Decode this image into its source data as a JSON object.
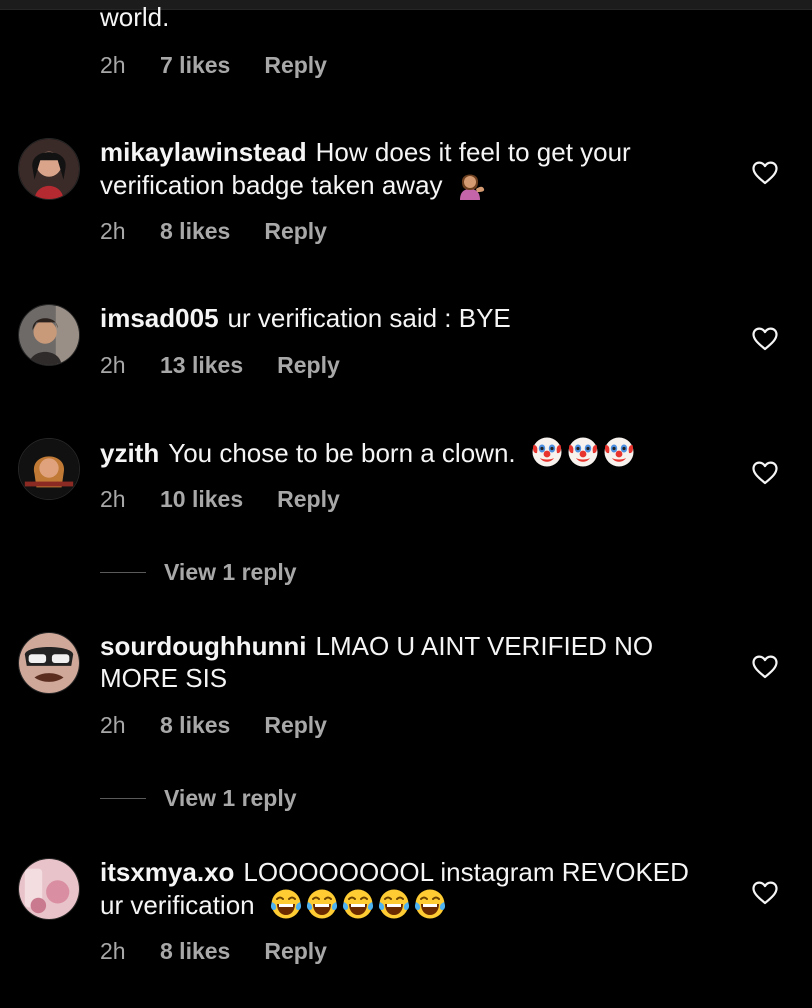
{
  "partial_comment": {
    "text_tail": "world.",
    "time": "2h",
    "likes": "7 likes",
    "reply": "Reply"
  },
  "comments": [
    {
      "username": "mikaylawinstead",
      "text": "How does it feel to get your verification badge taken away",
      "emoji": [
        "person-tipping-hand"
      ],
      "time": "2h",
      "likes": "8 likes",
      "reply": "Reply",
      "avatar": "avatar-mikaylawinstead"
    },
    {
      "username": "imsad005",
      "text": "ur verification said : BYE",
      "time": "2h",
      "likes": "13 likes",
      "reply": "Reply",
      "avatar": "avatar-imsad005"
    },
    {
      "username": "yzith",
      "text": "You chose to be born a clown.",
      "emoji": [
        "clown-face",
        "clown-face",
        "clown-face"
      ],
      "time": "2h",
      "likes": "10 likes",
      "reply": "Reply",
      "view_replies": "View 1 reply",
      "avatar": "avatar-yzith"
    },
    {
      "username": "sourdoughhunni",
      "text": "LMAO U AINT VERIFIED NO MORE SIS",
      "time": "2h",
      "likes": "8 likes",
      "reply": "Reply",
      "view_replies": "View 1 reply",
      "avatar": "avatar-sourdoughhunni"
    },
    {
      "username": "itsxmya.xo",
      "text": "LOOOOOOOOL instagram REVOKED ur verification",
      "emoji": [
        "tears-of-joy",
        "tears-of-joy",
        "tears-of-joy",
        "tears-of-joy",
        "tears-of-joy"
      ],
      "time": "2h",
      "likes": "8 likes",
      "reply": "Reply",
      "avatar": "avatar-itsxmya"
    }
  ],
  "icons": {
    "like": "heart-outline-icon"
  },
  "colors": {
    "background": "#000000",
    "text": "#f5f5f5",
    "secondary": "#a8a8a8"
  }
}
